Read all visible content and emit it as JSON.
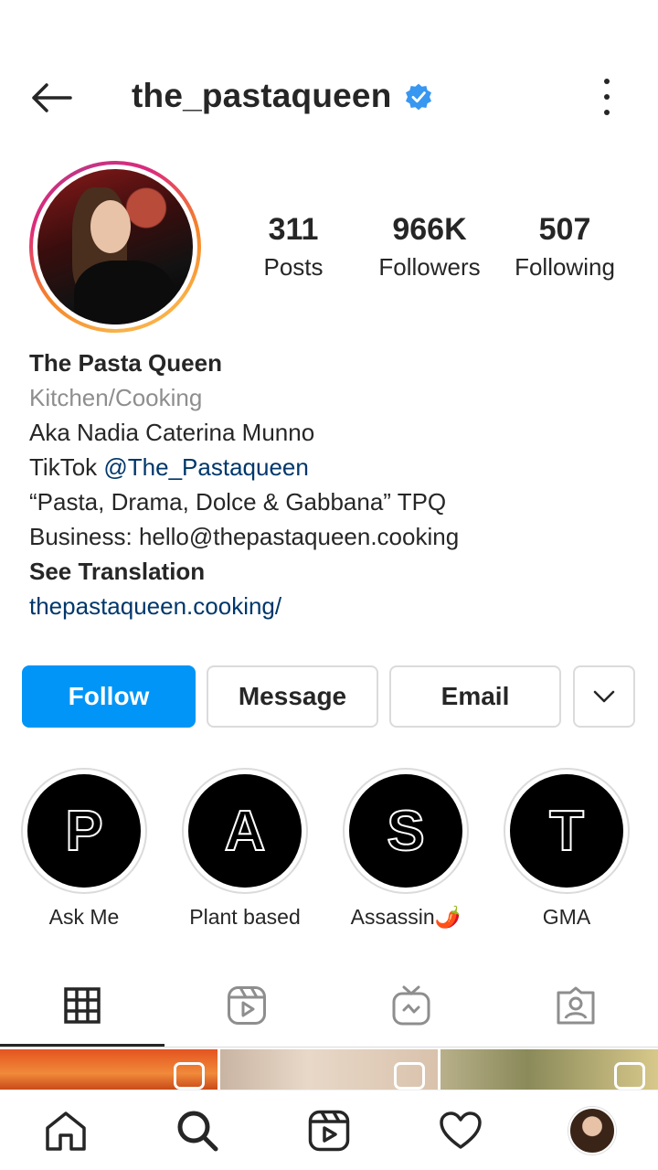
{
  "header": {
    "username": "the_pastaqueen",
    "verified_icon": "verified-badge-icon",
    "back_icon": "back-arrow-icon",
    "more_icon": "more-vertical-icon"
  },
  "stats": {
    "posts_count": "311",
    "posts_label": "Posts",
    "followers_count": "966K",
    "followers_label": "Followers",
    "following_count": "507",
    "following_label": "Following"
  },
  "bio": {
    "name": "The Pasta Queen",
    "category": "Kitchen/Cooking",
    "line1": "Aka Nadia Caterina Munno",
    "tiktok_prefix": "TikTok ",
    "tiktok_handle": "@The_Pastaqueen",
    "quote": "“Pasta, Drama, Dolce & Gabbana” TPQ",
    "business": "Business: hello@thepastaqueen.cooking",
    "see_translation": "See Translation",
    "website": "thepastaqueen.cooking/"
  },
  "actions": {
    "follow": "Follow",
    "message": "Message",
    "email": "Email",
    "more_icon": "chevron-down-icon"
  },
  "highlights": [
    {
      "letter": "P",
      "label": "Ask Me"
    },
    {
      "letter": "A",
      "label": "Plant based"
    },
    {
      "letter": "S",
      "label": "Assassin🌶️"
    },
    {
      "letter": "T",
      "label": "GMA"
    }
  ],
  "tabs": [
    "grid-icon",
    "reels-icon",
    "igtv-icon",
    "tagged-icon"
  ],
  "bottom_nav": [
    "home-icon",
    "search-icon",
    "reels-icon",
    "heart-icon",
    "profile-avatar"
  ],
  "colors": {
    "follow_button": "#0095f6",
    "link": "#00376b",
    "muted": "#8e8e8e",
    "verified": "#3897f0"
  }
}
